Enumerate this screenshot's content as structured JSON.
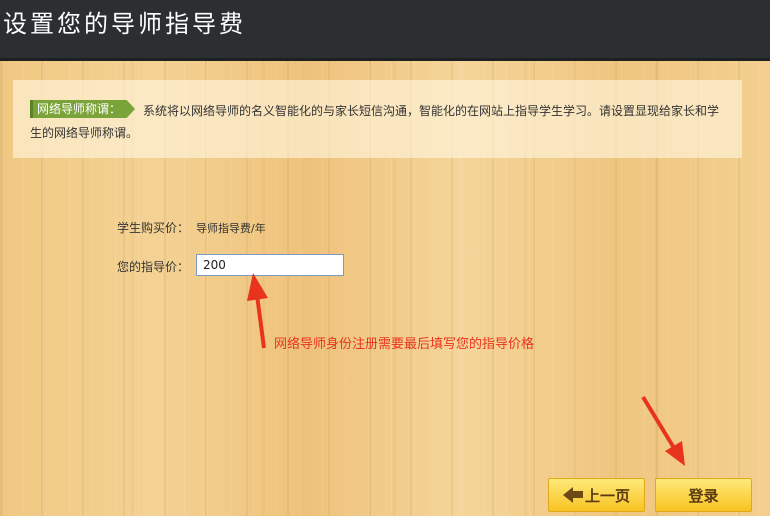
{
  "header": {
    "title": "设置您的导师指导费"
  },
  "notice": {
    "badge": "网络导师称谓：",
    "text": "系统将以网络导师的名义智能化的与家长短信沟通，智能化的在网站上指导学生学习。请设置显现给家长和学生的网络导师称谓。"
  },
  "form": {
    "purchase_price_label": "学生购买价：",
    "purchase_price_value": "导师指导费/年",
    "fee_label": "您的指导价：",
    "fee_value": "200"
  },
  "annotation": {
    "text": "网络导师身份注册需要最后填写您的指导价格",
    "color": "#e8341c"
  },
  "buttons": {
    "prev_label": "上一页",
    "login_label": "登录"
  },
  "icons": {
    "prev": "left-arrow-icon",
    "annotation_arrows": "red-arrow-icon"
  }
}
